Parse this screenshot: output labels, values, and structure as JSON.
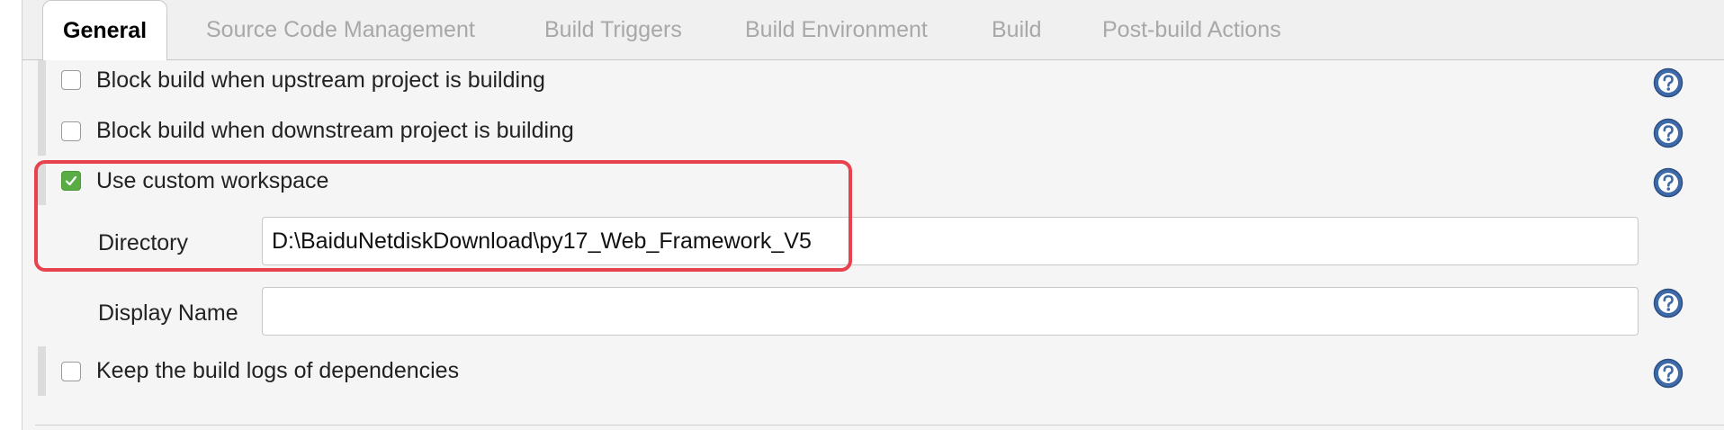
{
  "tabs": [
    {
      "label": "General",
      "active": true
    },
    {
      "label": "Source Code Management",
      "active": false
    },
    {
      "label": "Build Triggers",
      "active": false
    },
    {
      "label": "Build Environment",
      "active": false
    },
    {
      "label": "Build",
      "active": false
    },
    {
      "label": "Post-build Actions",
      "active": false
    }
  ],
  "options": {
    "block_upstream": {
      "label": "Block build when upstream project is building",
      "checked": false
    },
    "block_downstream": {
      "label": "Block build when downstream project is building",
      "checked": false
    },
    "custom_workspace": {
      "label": "Use custom workspace",
      "checked": true
    },
    "keep_logs": {
      "label": "Keep the build logs of dependencies",
      "checked": false
    }
  },
  "fields": {
    "directory": {
      "label": "Directory",
      "value": "D:\\BaiduNetdiskDownload\\py17_Web_Framework_V5"
    },
    "display_name": {
      "label": "Display Name",
      "value": "",
      "placeholder": ""
    }
  },
  "icons": {
    "help": "help-icon",
    "check": "check-icon"
  },
  "colors": {
    "highlight": "#e8424e",
    "checked": "#5aac45",
    "help_icon": "#3f6aa8",
    "active_tab_text": "#000000",
    "inactive_tab_text": "#a8a8a8"
  }
}
